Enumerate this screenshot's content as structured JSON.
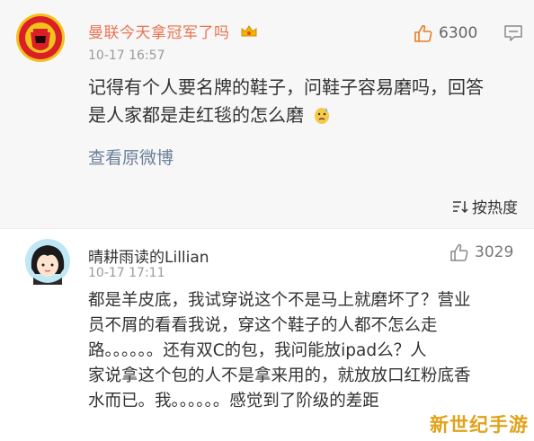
{
  "post": {
    "author": "曼联今天拿冠军了吗",
    "badge_icon": "crown-badge-icon",
    "time": "10-17 16:57",
    "likes": "6300",
    "text_line1": "记得有个人要名牌的鞋子，问鞋子容易磨吗，回答",
    "text_line2": "是人家都是走红毯的怎么磨",
    "view_original": "查看原微博"
  },
  "sort": {
    "label": "按热度"
  },
  "comment": {
    "author": "晴耕雨读的Lillian",
    "time": "10-17 17:11",
    "likes": "3029",
    "line1": "都是羊皮底，我试穿说这个不是马上就磨坏了？营业",
    "line2": "员不屑的看看我说，穿这个鞋子的人都不怎么走",
    "line3": "路。。。。。。还有双C的包，我问能放ipad么？人",
    "line4": "家说拿这个包的人不是拿来用的，就放放口红粉底香",
    "line5": "水而已。我。。。。。。感觉到了阶级的差距"
  },
  "watermark": "新世纪手游",
  "colors": {
    "author_name": "#eb7350",
    "link": "#6b7f98",
    "watermark": "#e0a31a"
  }
}
